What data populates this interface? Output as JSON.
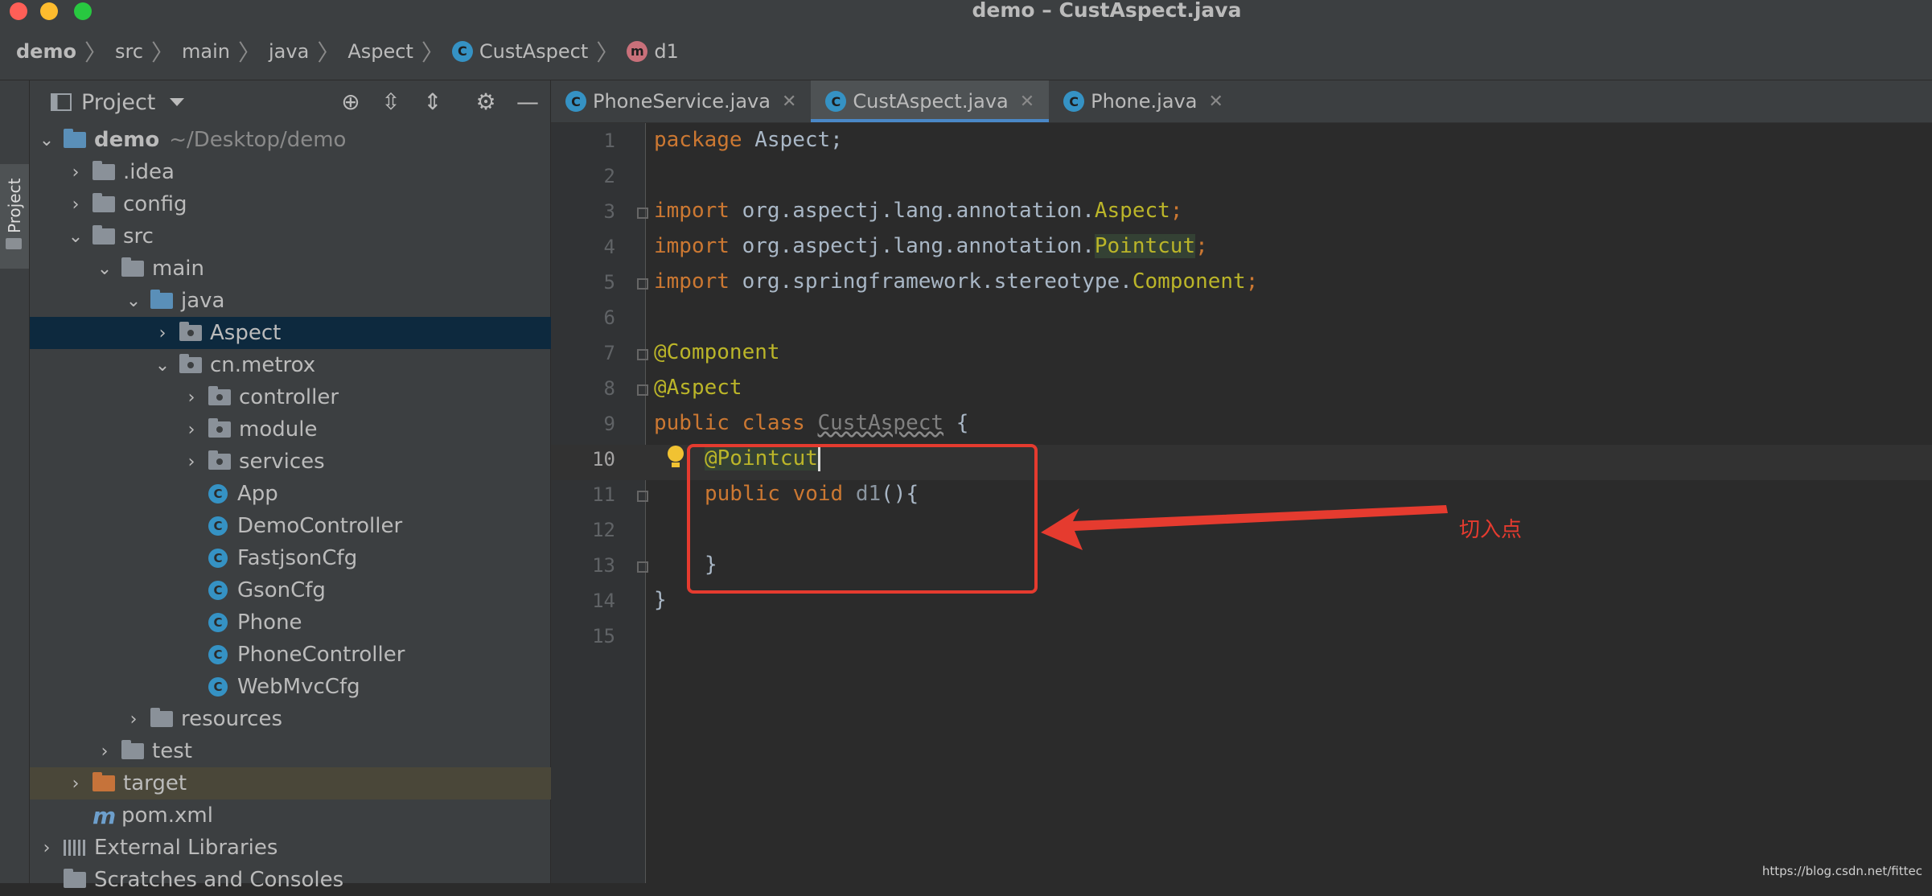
{
  "window": {
    "title": "demo – CustAspect.java"
  },
  "breadcrumb": {
    "items": [
      "demo",
      "src",
      "main",
      "java",
      "Aspect",
      "CustAspect",
      "d1"
    ]
  },
  "project_panel": {
    "title": "Project",
    "strip_label": "Project",
    "tree": {
      "root": {
        "label": "demo",
        "path": "~/Desktop/demo"
      },
      "idea": ".idea",
      "config": "config",
      "src": "src",
      "main": "main",
      "java": "java",
      "aspect": "Aspect",
      "cnmetrox": "cn.metrox",
      "controller": "controller",
      "module": "module",
      "services": "services",
      "app": "App",
      "democontroller": "DemoController",
      "fastjsoncfg": "FastjsonCfg",
      "gsoncfg": "GsonCfg",
      "phone": "Phone",
      "phonecontroller": "PhoneController",
      "webmvccfg": "WebMvcCfg",
      "resources": "resources",
      "test": "test",
      "target": "target",
      "pom": "pom.xml",
      "extlibs": "External Libraries",
      "scratches": "Scratches and Consoles"
    }
  },
  "tabs": [
    {
      "label": "PhoneService.java",
      "active": false
    },
    {
      "label": "CustAspect.java",
      "active": true
    },
    {
      "label": "Phone.java",
      "active": false
    }
  ],
  "editor": {
    "line_numbers": [
      "1",
      "2",
      "3",
      "4",
      "5",
      "6",
      "7",
      "8",
      "9",
      "10",
      "11",
      "12",
      "13",
      "14",
      "15"
    ],
    "current_line": "10",
    "code": {
      "l1_kw": "package",
      "l1_rest": " Aspect;",
      "l3_kw": "import",
      "l3_pkg": " org.aspectj.lang.annotation.",
      "l3_cls": "Aspect",
      "l3_end": ";",
      "l4_kw": "import",
      "l4_pkg": " org.aspectj.lang.annotation.",
      "l4_cls": "Pointcut",
      "l4_end": ";",
      "l5_kw": "import",
      "l5_pkg": " org.springframework.stereotype.",
      "l5_cls": "Component",
      "l5_end": ";",
      "l7": "@Component",
      "l8": "@Aspect",
      "l9_kw": "public class",
      "l9_name": "CustAspect",
      "l9_end": " {",
      "l10": "@Pointcut",
      "l11_kw": "public void",
      "l11_fn": "d1",
      "l11_end": "(){",
      "l13": "}",
      "l14": "}"
    }
  },
  "annotation": {
    "note": "切入点",
    "color": "#e53b2f"
  },
  "watermark": "https://blog.csdn.net/fittec",
  "colors": {
    "keyword": "#cc7832",
    "annotation": "#bbb529",
    "selection": "#0d293e",
    "tab_underline": "#4a88c7"
  }
}
